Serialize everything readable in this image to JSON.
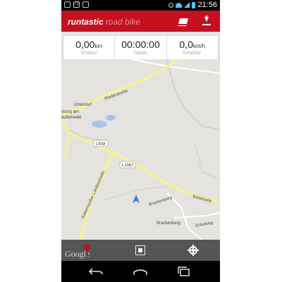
{
  "status_bar": {
    "time": "21:56",
    "left_icons": [
      "image-icon",
      "notification-count-icon",
      "android-icon"
    ],
    "notification_count": "71",
    "right_icons": [
      "alarm-icon",
      "wifi-icon",
      "signal-icon",
      "battery-icon"
    ]
  },
  "app_bar": {
    "brand": "runtastic",
    "product": "road bike",
    "brand_color": "#c4101f",
    "actions": [
      "layers-icon",
      "download-icon"
    ]
  },
  "stats": [
    {
      "value": "0,00",
      "unit": "km",
      "label": "Distanz"
    },
    {
      "value": "00:00:00",
      "unit": "",
      "label": "Dauer"
    },
    {
      "value": "0,0",
      "unit": "km/h",
      "label": "Geschw."
    }
  ],
  "map": {
    "labels": {
      "unterdorf": "Unterdorf",
      "riederstrasse": "Riederstraße",
      "sburg": "sburg am",
      "aeusserwald": "äußerwald",
      "l508": "L508",
      "l1067": "L1067",
      "kobernausser": "Kobernaußer Landesstraße",
      "badstrasse": "Badstraße",
      "brackenberg1": "Brackenberg",
      "brackenberg2": "Brackenberg",
      "schulweg": "Schulweg"
    },
    "road_color": "#f5f19a",
    "water_color": "#a9c4e8",
    "land_color": "#e5e3df",
    "location_marker_color": "#3c7fd8"
  },
  "bottom_bar": {
    "attribution": "Google",
    "actions": [
      "pin-icon",
      "expand-map-icon",
      "my-location-icon"
    ]
  },
  "nav_bar": {
    "buttons": [
      "back-icon",
      "home-icon",
      "recent-apps-icon"
    ]
  }
}
